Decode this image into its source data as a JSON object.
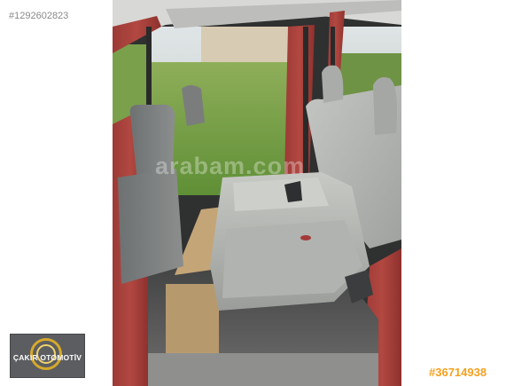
{
  "listing": {
    "id_text": "#1292602823",
    "ad_code": "#36714938",
    "watermark": "arabam.com"
  },
  "dealer": {
    "name": "ÇAKIR OTOMOTİV"
  },
  "colors": {
    "ad_code": "#f4a020",
    "listing_id": "#8a8a8a",
    "dealer_bg": "#5b5d60",
    "dealer_ring": "#d6a92b"
  }
}
